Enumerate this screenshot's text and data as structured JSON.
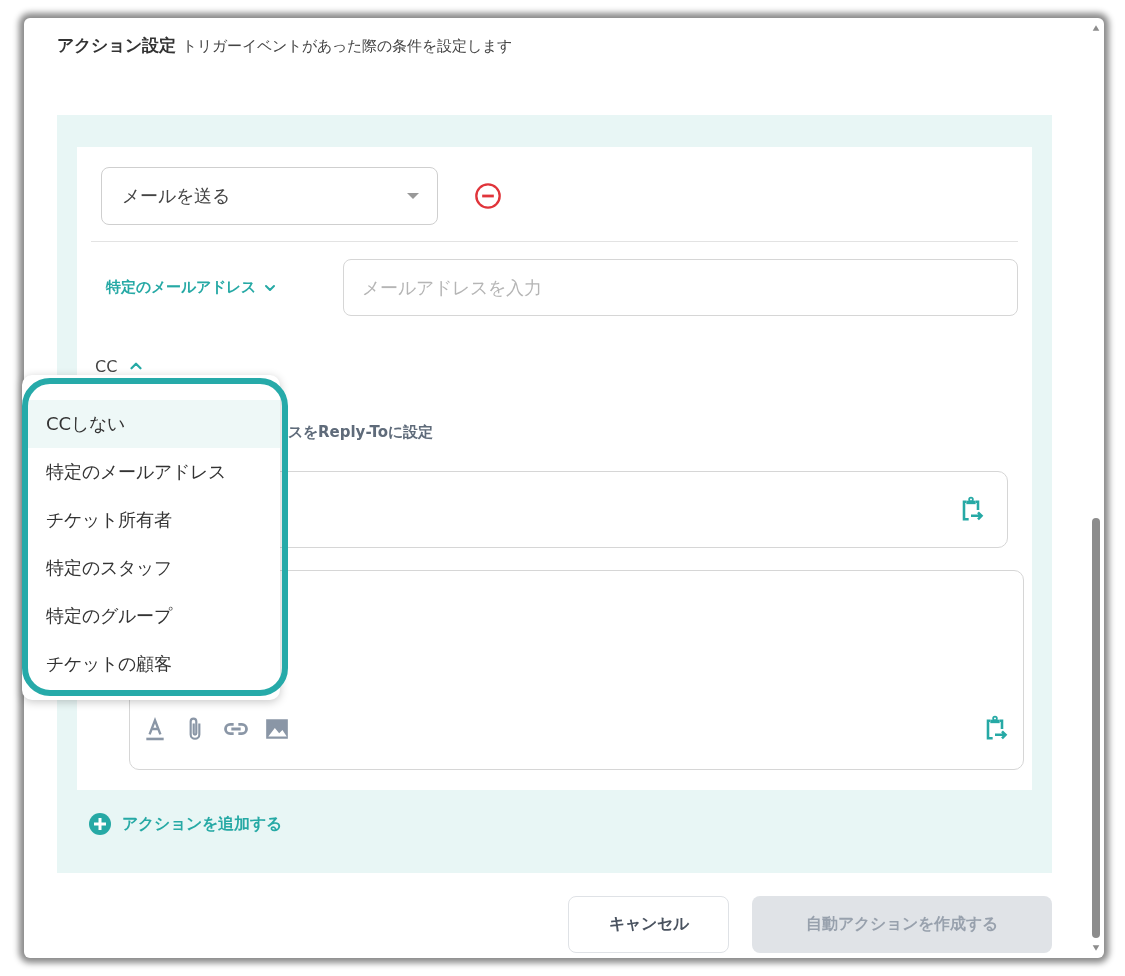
{
  "header": {
    "title": "アクション設定",
    "subtitle": "トリガーイベントがあった際の条件を設定します"
  },
  "action": {
    "select_value": "メールを送る",
    "recipient_type": "特定のメールアドレス",
    "recipient_expanded": false,
    "email_placeholder": "メールアドレスを入力",
    "cc_label": "CC",
    "cc_expanded": true,
    "reply_to_label": "スをReply-Toに設定"
  },
  "cc_menu": {
    "items": [
      {
        "label": "CCしない",
        "selected": true
      },
      {
        "label": "特定のメールアドレス",
        "selected": false
      },
      {
        "label": "チケット所有者",
        "selected": false
      },
      {
        "label": "特定のスタッフ",
        "selected": false
      },
      {
        "label": "特定のグループ",
        "selected": false
      },
      {
        "label": "チケットの顧客",
        "selected": false
      }
    ]
  },
  "add_action": "アクションを追加する",
  "buttons": [
    {
      "label": "キャンセル",
      "kind": "secondary",
      "disabled": false
    },
    {
      "label": "自動アクションを作成する",
      "kind": "primary",
      "disabled": true
    }
  ]
}
